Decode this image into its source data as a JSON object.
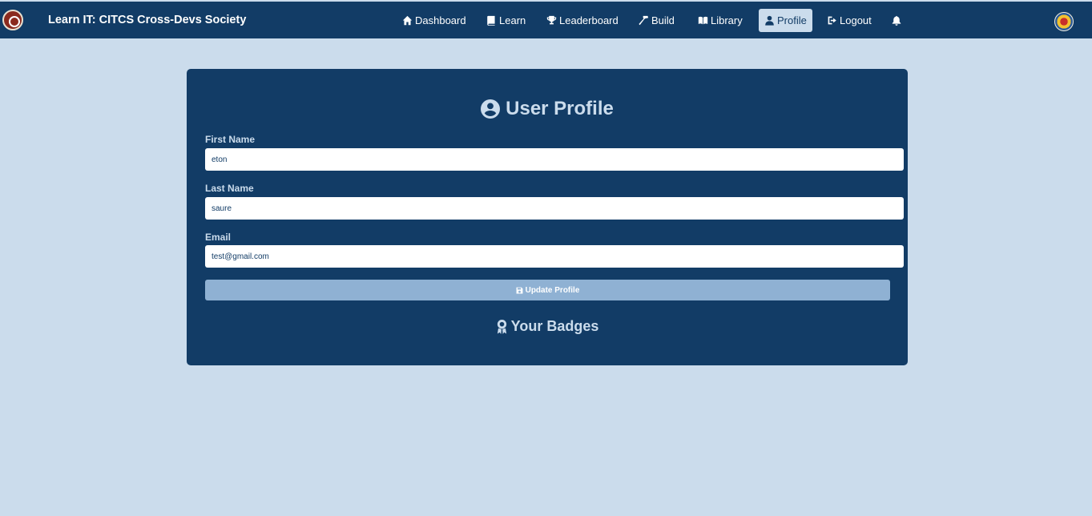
{
  "navbar": {
    "brand": "Learn IT: CITCS Cross-Devs Society",
    "items": [
      {
        "label": "Dashboard",
        "icon": "home-icon"
      },
      {
        "label": "Learn",
        "icon": "book-icon"
      },
      {
        "label": "Leaderboard",
        "icon": "trophy-icon"
      },
      {
        "label": "Build",
        "icon": "hammer-icon"
      },
      {
        "label": "Library",
        "icon": "open-book-icon"
      },
      {
        "label": "Profile",
        "icon": "user-icon",
        "active": true
      },
      {
        "label": "Logout",
        "icon": "logout-icon"
      }
    ]
  },
  "profile": {
    "title": "User Profile",
    "first_name_label": "First Name",
    "first_name_value": "eton",
    "last_name_label": "Last Name",
    "last_name_value": "saure",
    "email_label": "Email",
    "email_value": "test@gmail.com",
    "update_button": "Update Profile",
    "badges_title": "Your Badges"
  },
  "colors": {
    "navbar": "#123c66",
    "background": "#cbdcec",
    "button": "#8fb1d3"
  }
}
